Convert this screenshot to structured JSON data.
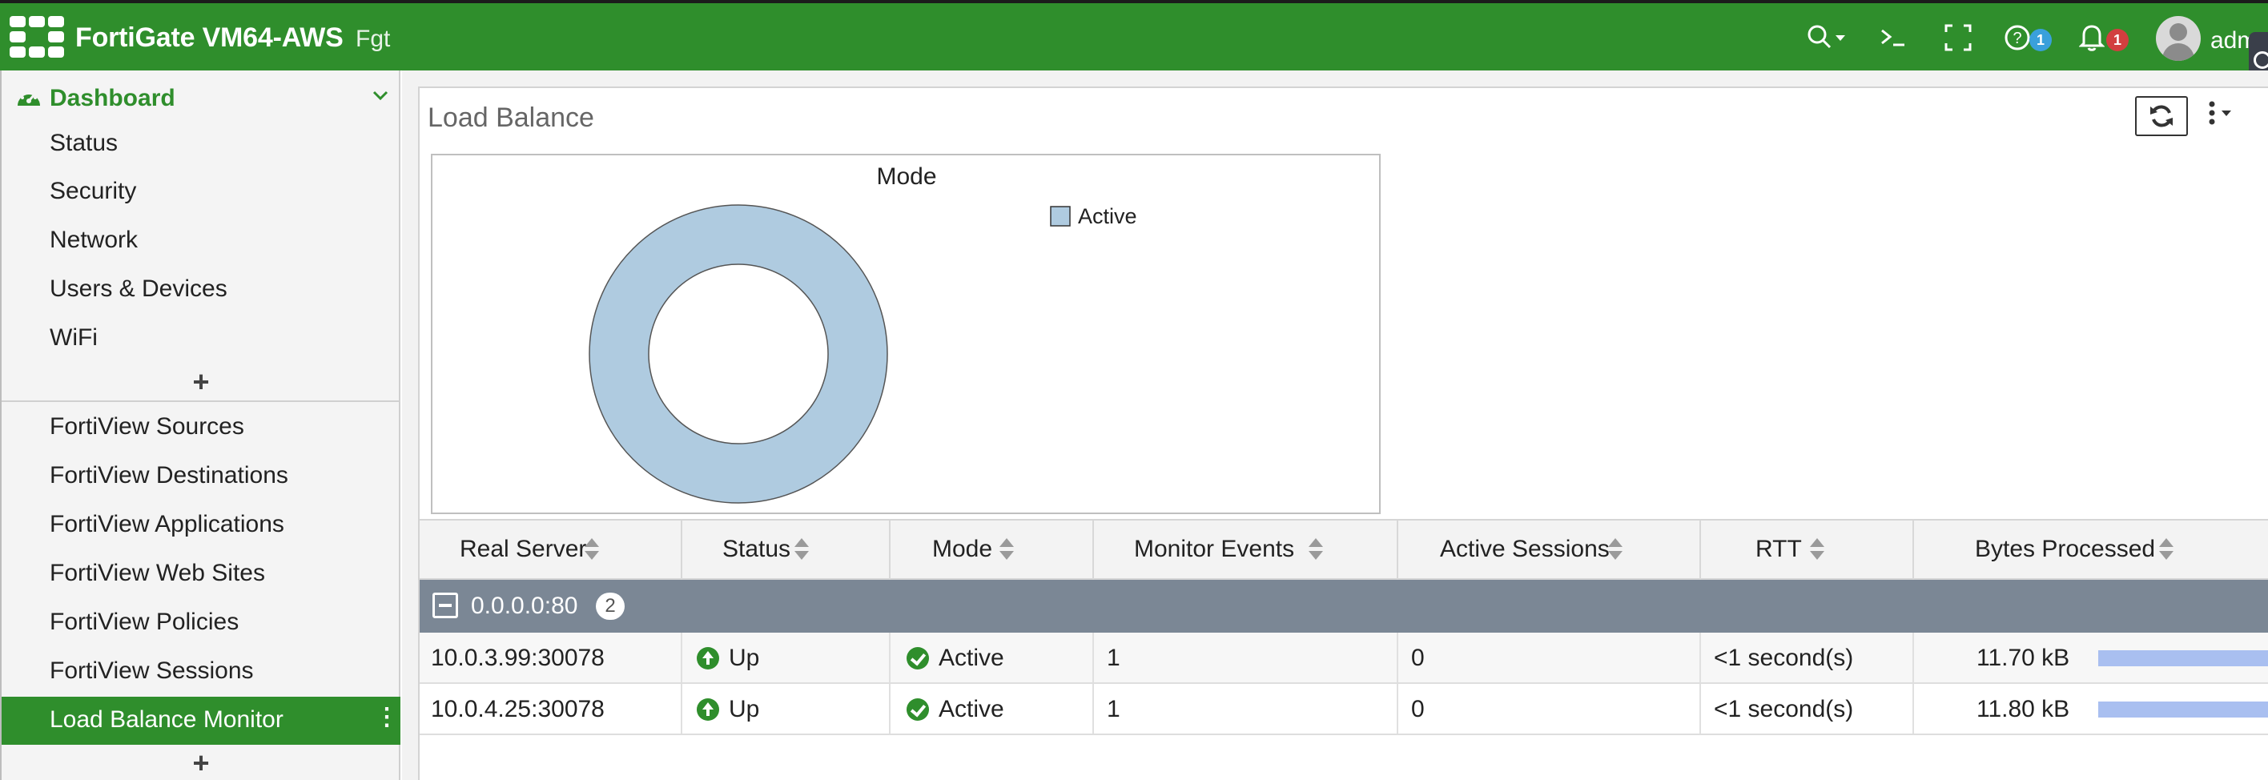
{
  "topbar": {
    "brand": "FortiGate VM64-AWS",
    "hostname": "Fgt",
    "help_badge": "1",
    "alerts_badge": "1",
    "user": "adm"
  },
  "sidebar": {
    "dashboard_label": "Dashboard",
    "items": [
      {
        "label": "Status"
      },
      {
        "label": "Security"
      },
      {
        "label": "Network"
      },
      {
        "label": "Users & Devices"
      },
      {
        "label": "WiFi"
      },
      {
        "label": "FortiView Sources"
      },
      {
        "label": "FortiView Destinations"
      },
      {
        "label": "FortiView Applications"
      },
      {
        "label": "FortiView Web Sites"
      },
      {
        "label": "FortiView Policies"
      },
      {
        "label": "FortiView Sessions"
      },
      {
        "label": "Load Balance Monitor"
      }
    ],
    "active_item": "Load Balance Monitor"
  },
  "widget": {
    "title": "Load Balance"
  },
  "chart_data": {
    "type": "pie",
    "title": "Mode",
    "categories": [
      "Active"
    ],
    "values": [
      2
    ],
    "colors": [
      "#afcbe0"
    ],
    "legend_placement": "top-right",
    "donut": true
  },
  "table": {
    "columns": [
      "Real Server",
      "Status",
      "Mode",
      "Monitor Events",
      "Active Sessions",
      "RTT",
      "Bytes Processed"
    ],
    "group": {
      "label": "0.0.0.0:80",
      "count": "2"
    },
    "rows": [
      {
        "real_server": "10.0.3.99:30078",
        "status": "Up",
        "mode": "Active",
        "monitor_events": "1",
        "active_sessions": "0",
        "rtt": "<1 second(s)",
        "bytes": "11.70 kB",
        "bytes_fraction": 0.99
      },
      {
        "real_server": "10.0.4.25:30078",
        "status": "Up",
        "mode": "Active",
        "monitor_events": "1",
        "active_sessions": "0",
        "rtt": "<1 second(s)",
        "bytes": "11.80 kB",
        "bytes_fraction": 1.0
      }
    ]
  }
}
